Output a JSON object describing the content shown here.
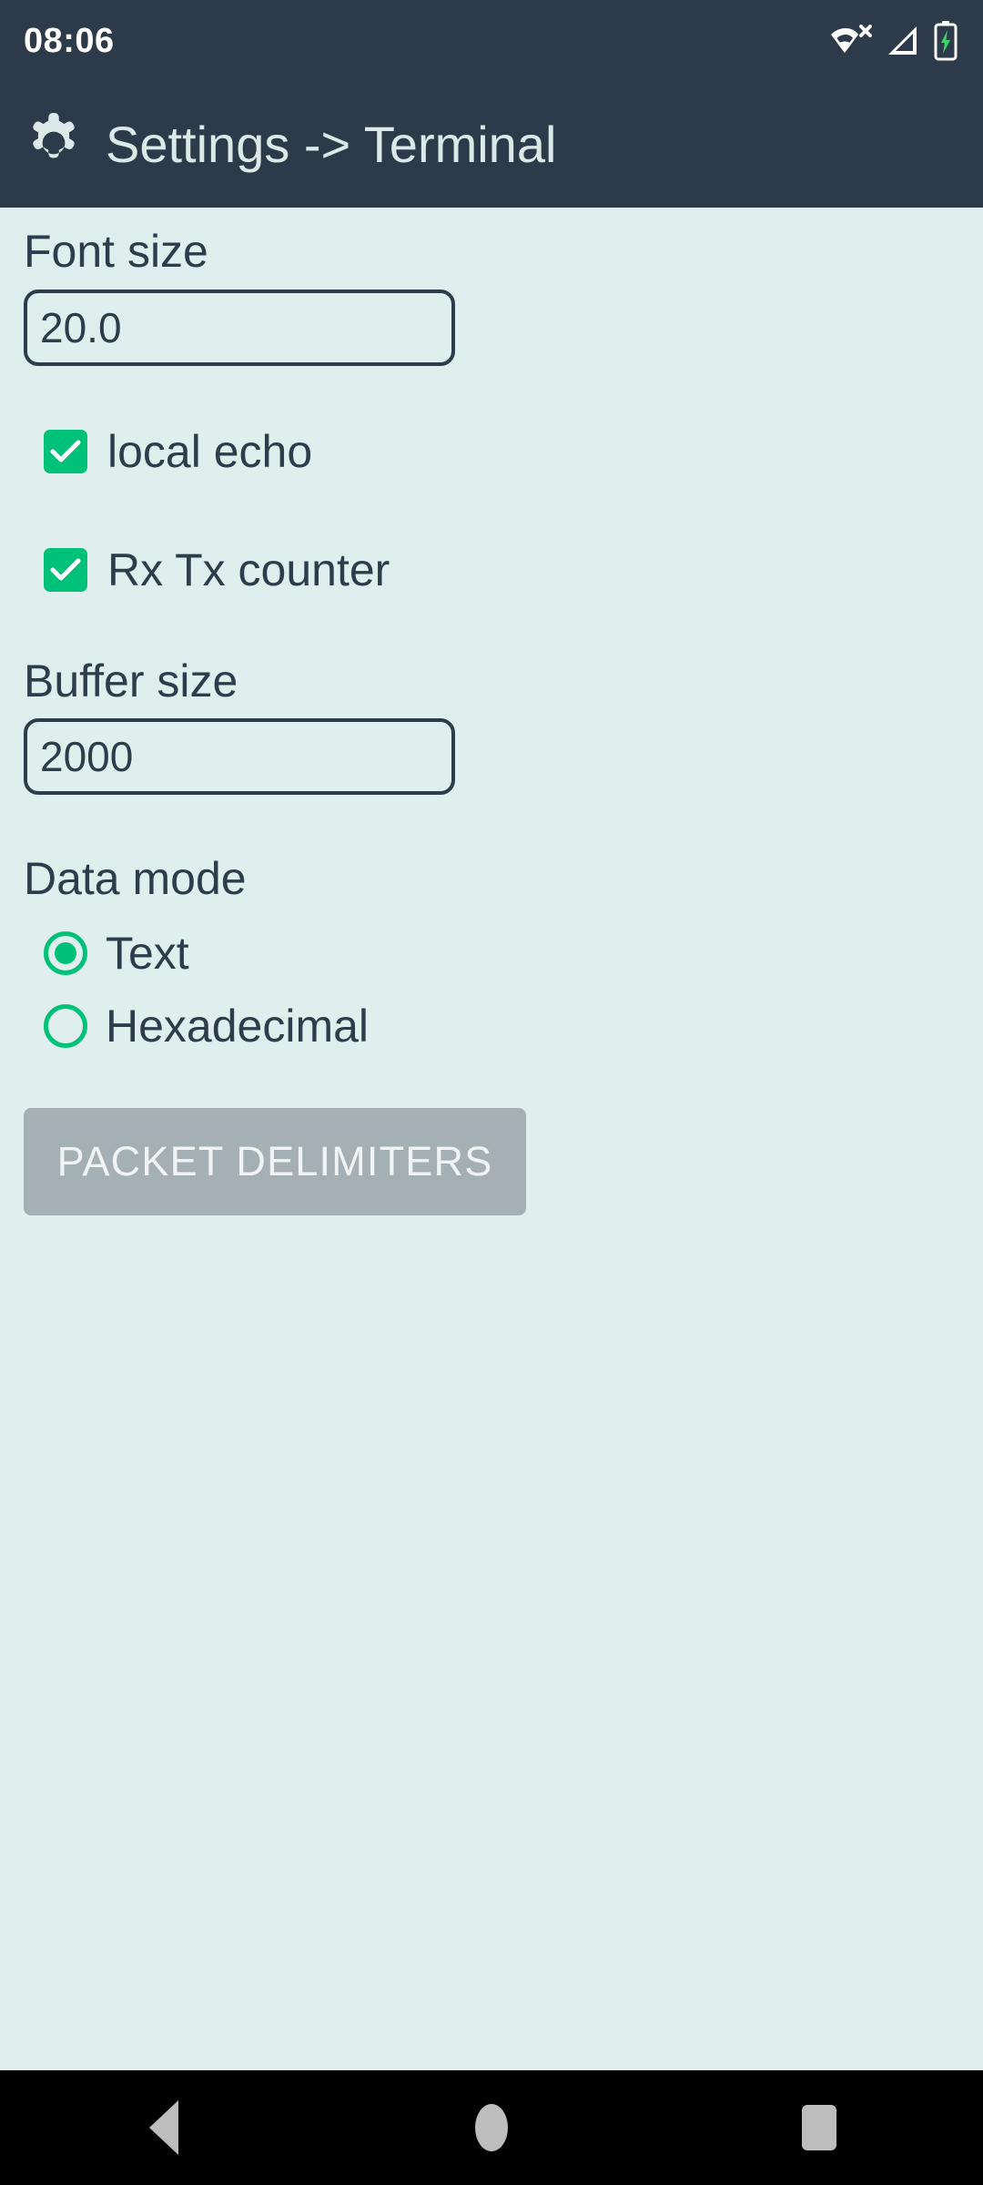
{
  "status_bar": {
    "clock": "08:06",
    "icons": [
      {
        "name": "wifi-off-icon",
        "label": "wifi-no-connection"
      },
      {
        "name": "cellular-signal-icon",
        "label": "mobile-signal"
      },
      {
        "name": "battery-charging-icon",
        "label": "battery-charging"
      }
    ],
    "background_color": "#2C3A4A",
    "text_color": "#FFFFFF",
    "battery_bolt_color": "#3DD16A"
  },
  "app_bar": {
    "icon": "gear-icon",
    "title": "Settings -> Terminal",
    "background_color": "#2C3A4A",
    "title_color": "#DCE9E8"
  },
  "content": {
    "background_color": "#E0EFED",
    "text_color": "#2E3D4C",
    "accent_color": "#00C178",
    "font_size": {
      "label": "Font size",
      "value": "20.0",
      "placeholder": "Font size"
    },
    "local_echo": {
      "label": "local echo",
      "checked": true
    },
    "rx_tx_counter": {
      "label": "Rx Tx counter",
      "checked": true
    },
    "buffer_size": {
      "label": "Buffer size",
      "value": "2000",
      "placeholder": "Buffer size"
    },
    "data_mode": {
      "label": "Data mode",
      "selected": "Text",
      "options": [
        {
          "label": "Text",
          "selected": true
        },
        {
          "label": "Hexadecimal",
          "selected": false
        }
      ]
    },
    "packet_delimiters_button": {
      "label": "PACKET DELIMITERS",
      "background_color": "#A4B0B4",
      "text_color": "#F0F4F5"
    }
  },
  "nav_bar": {
    "background_color": "#000000",
    "icon_color": "#BDBDBD",
    "buttons": [
      {
        "name": "nav-back-button",
        "label": "Back"
      },
      {
        "name": "nav-home-button",
        "label": "Home"
      },
      {
        "name": "nav-recents-button",
        "label": "Recents"
      }
    ]
  }
}
